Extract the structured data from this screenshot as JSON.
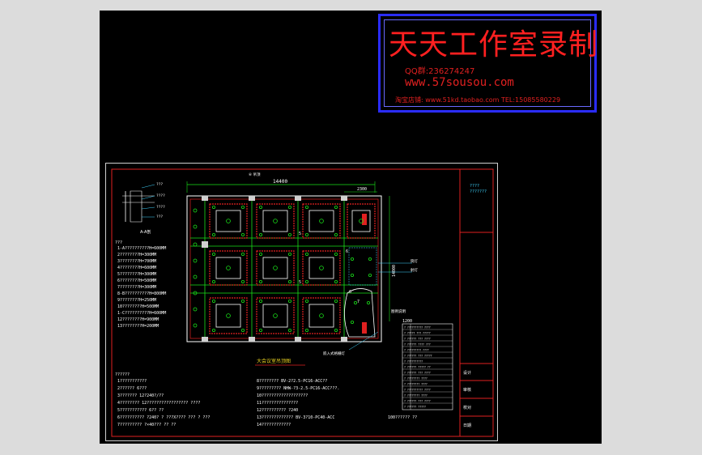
{
  "watermark": {
    "title": "天天工作室录制",
    "qq": "QQ群:236274247",
    "website": "www.57sousou.com",
    "shop": "淘宝店铺: www.51kd.taobao.com  TEL:15085580229"
  },
  "plan": {
    "overall_width": "14400",
    "bay_width": "2300",
    "right_dim": "14000",
    "small_dim": "1200",
    "caption": "大会议室吊顶图",
    "top_tag": "⑥ 吊顶",
    "side_tag_1": "筒灯",
    "side_tag_2": "射灯",
    "legend_tag": "图例说明",
    "bottom_tag": "嵌入式格栅灯",
    "grid_marks": [
      "5",
      "5",
      "6",
      "6",
      "7"
    ]
  },
  "detail": {
    "label": "A-A剖",
    "lines": [
      "???",
      "????",
      "????",
      "???"
    ]
  },
  "notes": {
    "header": "???",
    "lines": [
      "1-A??????????H=600MM",
      "2????????H=300MM",
      "3????????H=700MM",
      "4????????H=600MM",
      "5????????H=300MM",
      "6????????H=500MM",
      "7????????H=300MM",
      "8-B??????????H=800MM",
      "9????????H=250MM",
      "10????????H=500MM",
      "1-C??????????H=600MM",
      "12????????H=900MM",
      "13????????H=200MM"
    ]
  },
  "general_notes": {
    "header": "??????",
    "left": [
      "1???????????",
      "2?????? 6???",
      "3??????? 12?240?/??",
      "4???????? 12?????????????????    ????",
      "5??????????? 6?? ??",
      "6??????????   ?240? ?  ???X???? ??? ? ???",
      "7????????? ?×40??? ?? ??"
    ],
    "right": [
      "8????????  BV-2?2.5-PC16-ACC??",
      "9?????????  NHW-?3-2.5-PC16-ACC???.",
      "10???????????????????",
      "11???????????????",
      "12??????????  ?240",
      "13????????????? BV-3?10-PC40-ACC",
      "14????????????"
    ],
    "footer": "100??????   ??"
  },
  "legend": {
    "rows": [
      "? ?????????? ????",
      "? ????? ??? ?????",
      "? ?????? ??? ????",
      "? ?????? ???? ???",
      "? ????????? ????",
      "? ?????? ??? ?????",
      "? ??????????",
      "? ?????? ????? ??",
      "? ?????? ??? ????",
      "? ???????? ????",
      "? ???????? ????",
      "? ?????????? ????",
      "? ???????? ????",
      "? ?????? ??? ????",
      "? ?????? ?????"
    ]
  },
  "title_block": {
    "top": "????",
    "top2": "???????",
    "rows": [
      "设计",
      "审核",
      "校对",
      "日期"
    ]
  }
}
